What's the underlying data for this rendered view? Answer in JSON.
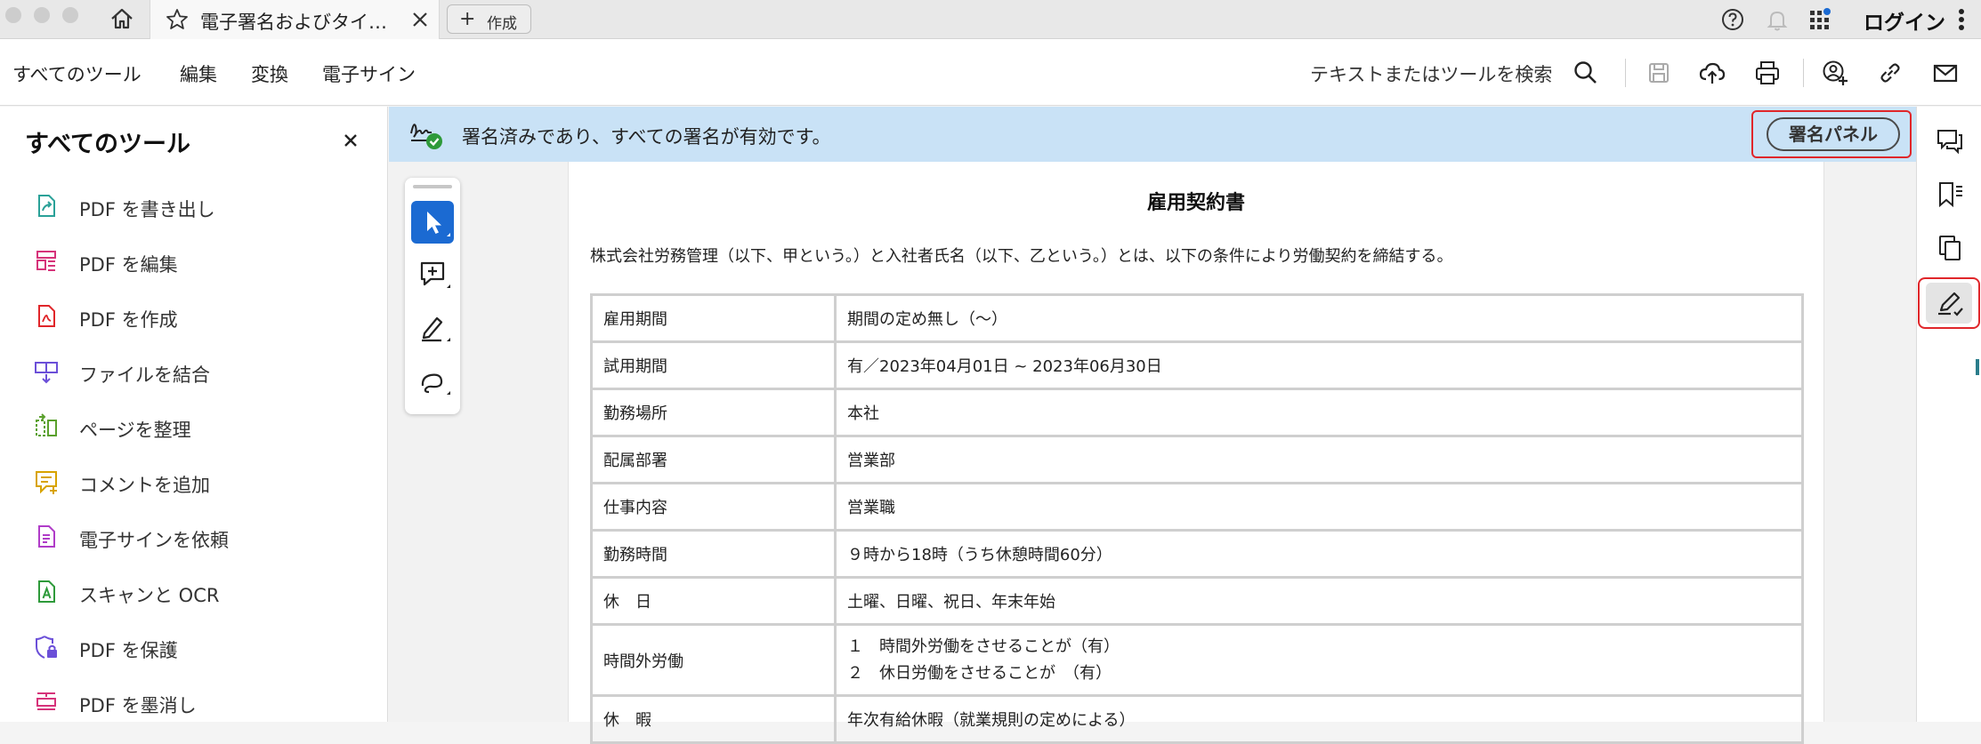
{
  "window": {
    "tab_title": "電子署名およびタイ…",
    "new_tab_label": "作成",
    "login_label": "ログイン"
  },
  "menubar": {
    "items": [
      "すべてのツール",
      "編集",
      "変換",
      "電子サイン"
    ],
    "active_index": 0,
    "search_label": "テキストまたはツールを検索"
  },
  "left_panel": {
    "title": "すべてのツール",
    "tools": [
      {
        "label": "PDF を書き出し",
        "icon": "export-pdf-icon",
        "color": "#2aa198"
      },
      {
        "label": "PDF を編集",
        "icon": "edit-pdf-icon",
        "color": "#d6337a"
      },
      {
        "label": "PDF を作成",
        "icon": "create-pdf-icon",
        "color": "#e0262a"
      },
      {
        "label": "ファイルを結合",
        "icon": "combine-files-icon",
        "color": "#6b4fd8"
      },
      {
        "label": "ページを整理",
        "icon": "organize-pages-icon",
        "color": "#5aa02c"
      },
      {
        "label": "コメントを追加",
        "icon": "add-comment-icon",
        "color": "#d8a300"
      },
      {
        "label": "電子サインを依頼",
        "icon": "request-esign-icon",
        "color": "#b03cc8"
      },
      {
        "label": "スキャンと OCR",
        "icon": "scan-ocr-icon",
        "color": "#2e9a3a"
      },
      {
        "label": "PDF を保護",
        "icon": "protect-pdf-icon",
        "color": "#6b4fd8"
      },
      {
        "label": "PDF を墨消し",
        "icon": "redact-pdf-icon",
        "color": "#d6337a"
      }
    ]
  },
  "signature_bar": {
    "message": "署名済みであり、すべての署名が有効です。",
    "panel_button": "署名パネル"
  },
  "document": {
    "title": "雇用契約書",
    "intro": "株式会社労務管理（以下、甲という。）と入社者氏名（以下、乙という。）とは、以下の条件により労働契約を締結する。",
    "rows": [
      {
        "label": "雇用期間",
        "value": "期間の定め無し（〜）"
      },
      {
        "label": "試用期間",
        "value": "有／2023年04月01日 ~ 2023年06月30日"
      },
      {
        "label": "勤務場所",
        "value": "本社"
      },
      {
        "label": "配属部署",
        "value": "営業部"
      },
      {
        "label": "仕事内容",
        "value": "営業職"
      },
      {
        "label": "勤務時間",
        "value": "９時から18時（うち休憩時間60分）"
      },
      {
        "label": "休　日",
        "value": "土曜、日曜、祝日、年末年始"
      }
    ],
    "overtime": {
      "label": "時間外労働",
      "line1": "１　時間外労働をさせることが（有）",
      "line2": "２　休日労働をさせることが　（有）"
    },
    "partial_row": {
      "label": "休　暇",
      "value": "年次有給休暇（就業規則の定めによる）"
    }
  },
  "colors": {
    "accent_blue": "#1b6ad2",
    "highlight_red": "#e0262a",
    "signature_bar_bg": "#c9e2f6"
  }
}
